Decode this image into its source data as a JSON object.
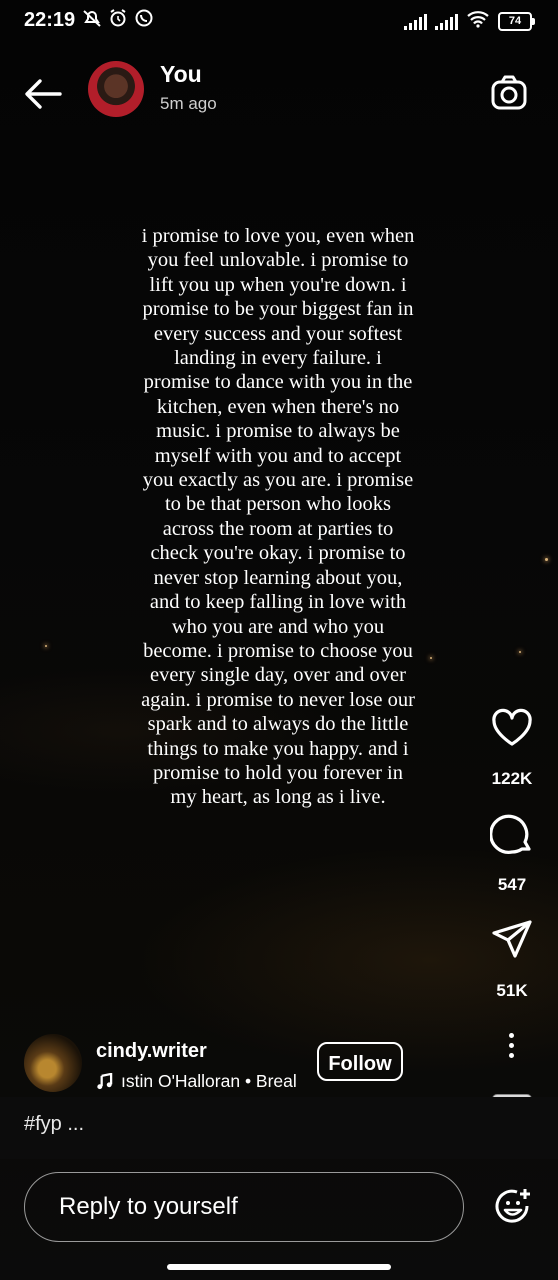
{
  "status_bar": {
    "time": "22:19",
    "battery": "74",
    "left_icons": [
      "mute-bell-icon",
      "alarm-icon",
      "whatsapp-icon"
    ],
    "right_icons": [
      "signal-icon",
      "signal-icon",
      "wifi-icon",
      "battery-icon"
    ]
  },
  "header": {
    "title": "You",
    "subtitle": "5m ago",
    "back_icon": "arrow-left-icon",
    "camera_icon": "camera-icon"
  },
  "post": {
    "text": "i promise to love you, even when you feel unlovable. i promise to lift you up when you're down. i promise to be your biggest fan in every success and your softest landing in every failure. i promise to dance with you in the kitchen, even when there's no music. i promise to always be myself with you and to accept you exactly as you are. i promise to be that person who looks across the room at parties to check you're okay. i promise to never stop learning about you, and to keep falling in love with who you are and who you become. i promise to choose you every single day, over and over again. i promise to never lose our spark and to always do the little things to make you happy. and i promise to hold you forever in my heart, as long as i live."
  },
  "actions": {
    "likes": "122K",
    "comments": "547",
    "shares": "51K"
  },
  "creator": {
    "username": "cindy.writer",
    "music": "ıstin O'Halloran • Breal",
    "follow_label": "Follow"
  },
  "caption": "#fyp ...",
  "reply": {
    "placeholder": "Reply to yourself"
  },
  "colors": {
    "background": "#000000",
    "text": "#ffffff",
    "muted": "#cfcfcf"
  }
}
